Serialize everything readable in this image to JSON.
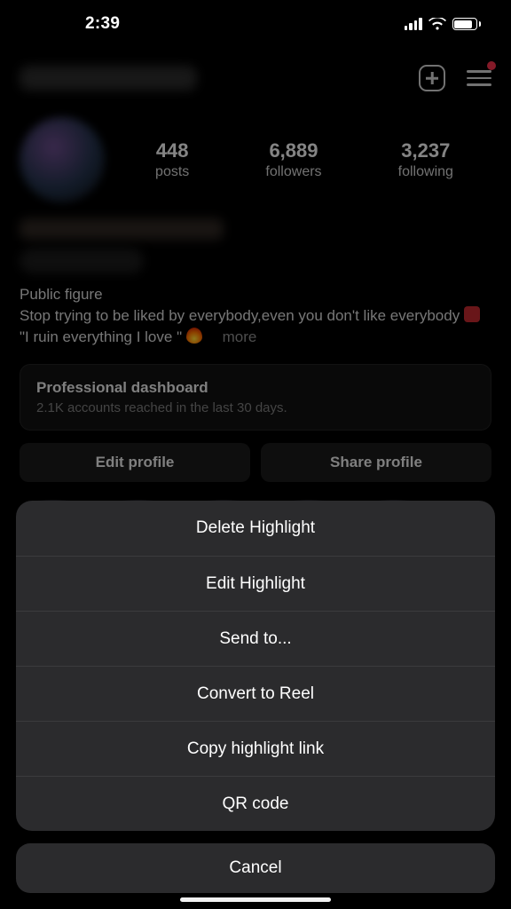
{
  "status": {
    "time": "2:39"
  },
  "profile": {
    "stats": {
      "posts": {
        "value": "448",
        "label": "posts"
      },
      "followers": {
        "value": "6,889",
        "label": "followers"
      },
      "following": {
        "value": "3,237",
        "label": "following"
      }
    },
    "category": "Public figure",
    "bio_line1": "Stop trying to be liked by everybody,even you don't like everybody ",
    "bio_line2_prefix": "\"I ruin everything I love \"",
    "more_label": "more",
    "dashboard": {
      "title": "Professional dashboard",
      "subtitle": "2.1K accounts reached in the last 30 days."
    },
    "buttons": {
      "edit": "Edit profile",
      "share": "Share profile"
    }
  },
  "sheet": {
    "items": [
      "Delete Highlight",
      "Edit Highlight",
      "Send to...",
      "Convert to Reel",
      "Copy highlight link",
      "QR code"
    ],
    "cancel": "Cancel"
  }
}
